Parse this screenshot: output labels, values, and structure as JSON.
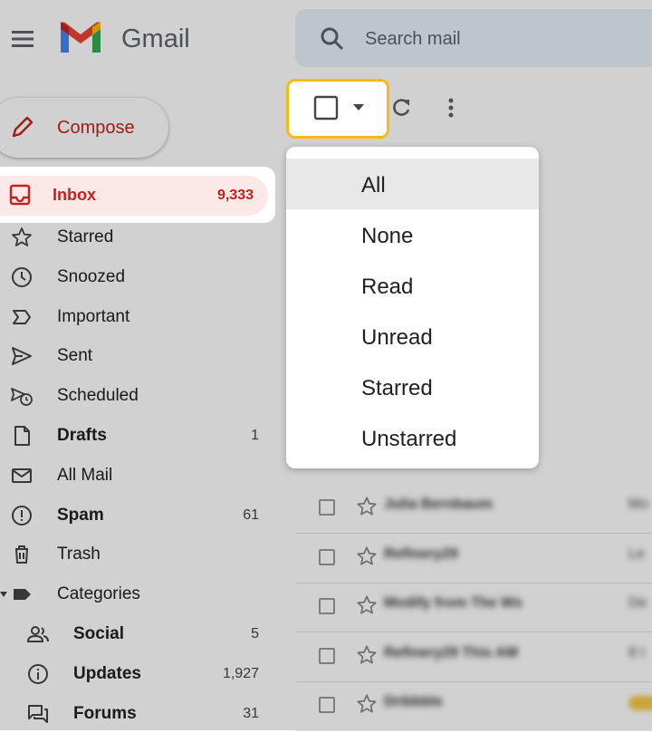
{
  "header": {
    "brand": "Gmail",
    "search_placeholder": "Search mail"
  },
  "compose": {
    "label": "Compose"
  },
  "nav": {
    "inbox": {
      "label": "Inbox",
      "count": "9,333"
    },
    "items": [
      {
        "label": "Starred",
        "count": "",
        "icon": "star-icon",
        "bold": false
      },
      {
        "label": "Snoozed",
        "count": "",
        "icon": "clock-icon",
        "bold": false
      },
      {
        "label": "Important",
        "count": "",
        "icon": "important-icon",
        "bold": false
      },
      {
        "label": "Sent",
        "count": "",
        "icon": "send-icon",
        "bold": false
      },
      {
        "label": "Scheduled",
        "count": "",
        "icon": "scheduled-icon",
        "bold": false
      },
      {
        "label": "Drafts",
        "count": "1",
        "icon": "draft-icon",
        "bold": true
      },
      {
        "label": "All Mail",
        "count": "",
        "icon": "mail-icon",
        "bold": false
      },
      {
        "label": "Spam",
        "count": "61",
        "icon": "spam-icon",
        "bold": true
      },
      {
        "label": "Trash",
        "count": "",
        "icon": "trash-icon",
        "bold": false
      },
      {
        "label": "Categories",
        "count": "",
        "icon": "label-icon",
        "bold": false
      }
    ],
    "categories": [
      {
        "label": "Social",
        "count": "5",
        "icon": "people-icon"
      },
      {
        "label": "Updates",
        "count": "1,927",
        "icon": "info-icon"
      },
      {
        "label": "Forums",
        "count": "31",
        "icon": "forum-icon"
      }
    ]
  },
  "select_menu": {
    "options": [
      "All",
      "None",
      "Read",
      "Unread",
      "Starred",
      "Unstarred"
    ],
    "highlighted": "All"
  },
  "mail_list": [
    {
      "sender": "Julia Bernbaum",
      "subject": "Mo"
    },
    {
      "sender": "Refinery29",
      "subject": "Le"
    },
    {
      "sender": "Modify from The Ws",
      "subject": "De"
    },
    {
      "sender": "Refinery29 This AM",
      "subject": "8 t"
    },
    {
      "sender": "Dribbble",
      "subject": ""
    }
  ],
  "colors": {
    "accent_red": "#c5221f",
    "inbox_highlight": "#fce8e6",
    "focus_ring": "#f5bd14"
  }
}
